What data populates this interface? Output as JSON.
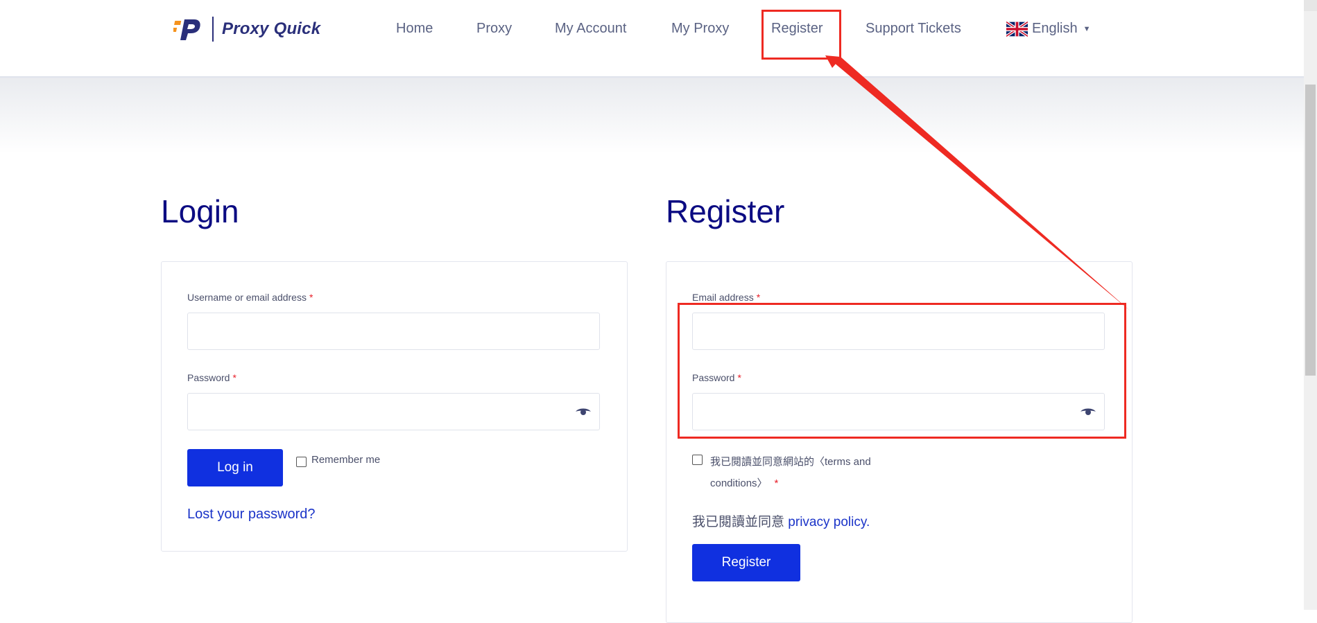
{
  "brand": {
    "name": "Proxy Quick"
  },
  "nav": {
    "items": [
      "Home",
      "Proxy",
      "My Account",
      "My Proxy",
      "Register",
      "Support Tickets"
    ],
    "language": "English"
  },
  "login": {
    "title": "Login",
    "username_label": "Username or email address",
    "password_label": "Password",
    "required_mark": "*",
    "button": "Log in",
    "remember": "Remember me",
    "lost_password": "Lost your password?"
  },
  "register": {
    "title": "Register",
    "email_label": "Email address",
    "password_label": "Password",
    "required_mark": "*",
    "terms_line1": "我已閱讀並同意網站的〈terms and",
    "terms_line2": "conditions〉",
    "privacy_prefix": "我已閱讀並同意",
    "privacy_link": "privacy policy",
    "privacy_suffix": ".",
    "button": "Register"
  },
  "colors": {
    "accent": "#1030e0",
    "heading": "#0b0b82",
    "annotation": "#ee2a22",
    "brand": "#2a2f7a",
    "brand_orange": "#f5931e"
  },
  "icons": [
    "logo-icon",
    "uk-flag-icon",
    "caret-down-icon",
    "eye-icon"
  ]
}
